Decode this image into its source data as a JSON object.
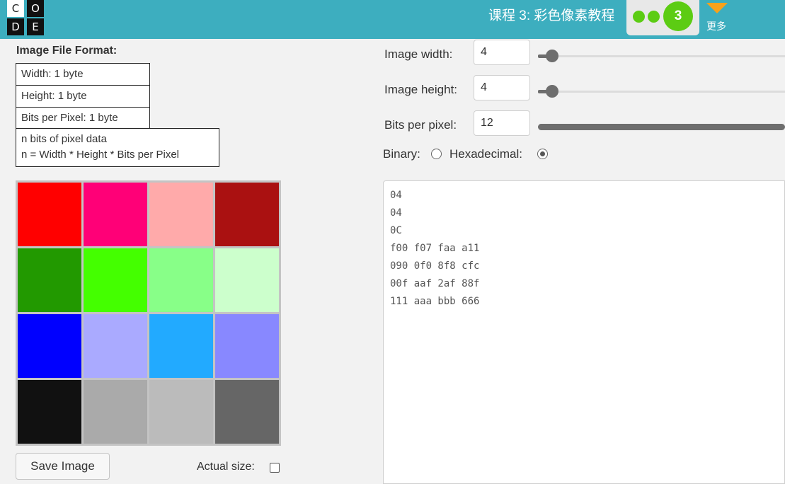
{
  "header": {
    "logo_letters": [
      "C",
      "O",
      "D",
      "E"
    ],
    "lesson_title": "课程 3: 彩色像素教程",
    "current_level": "3",
    "more_label": "更多"
  },
  "format": {
    "title": "Image File Format:",
    "rows": [
      "Width: 1 byte",
      "Height: 1 byte",
      "Bits per Pixel: 1 byte"
    ],
    "pixel_data_line1": "n bits of pixel data",
    "pixel_data_line2": "n = Width * Height * Bits per Pixel"
  },
  "pixel_grid": {
    "colors": [
      "#ff0000",
      "#ff0077",
      "#ffaaaa",
      "#aa1111",
      "#229900",
      "#44ff00",
      "#88ff88",
      "#ccffcc",
      "#0000ff",
      "#aaaaff",
      "#22aaff",
      "#8888ff",
      "#111111",
      "#aaaaaa",
      "#bbbbbb",
      "#666666"
    ]
  },
  "controls": {
    "width_label": "Image width:",
    "width_value": "4",
    "height_label": "Image height:",
    "height_value": "4",
    "bpp_label": "Bits per pixel:",
    "bpp_value": "12",
    "binary_label": "Binary:",
    "hex_label": "Hexadecimal:",
    "selected_format": "hexadecimal"
  },
  "hex_data": [
    "04",
    "04",
    "0C",
    "f00 f07 faa a11",
    "090 0f0 8f8 cfc",
    "00f aaf 2af 88f",
    "111 aaa bbb 666"
  ],
  "actions": {
    "save_label": "Save Image",
    "actual_size_label": "Actual size:"
  }
}
